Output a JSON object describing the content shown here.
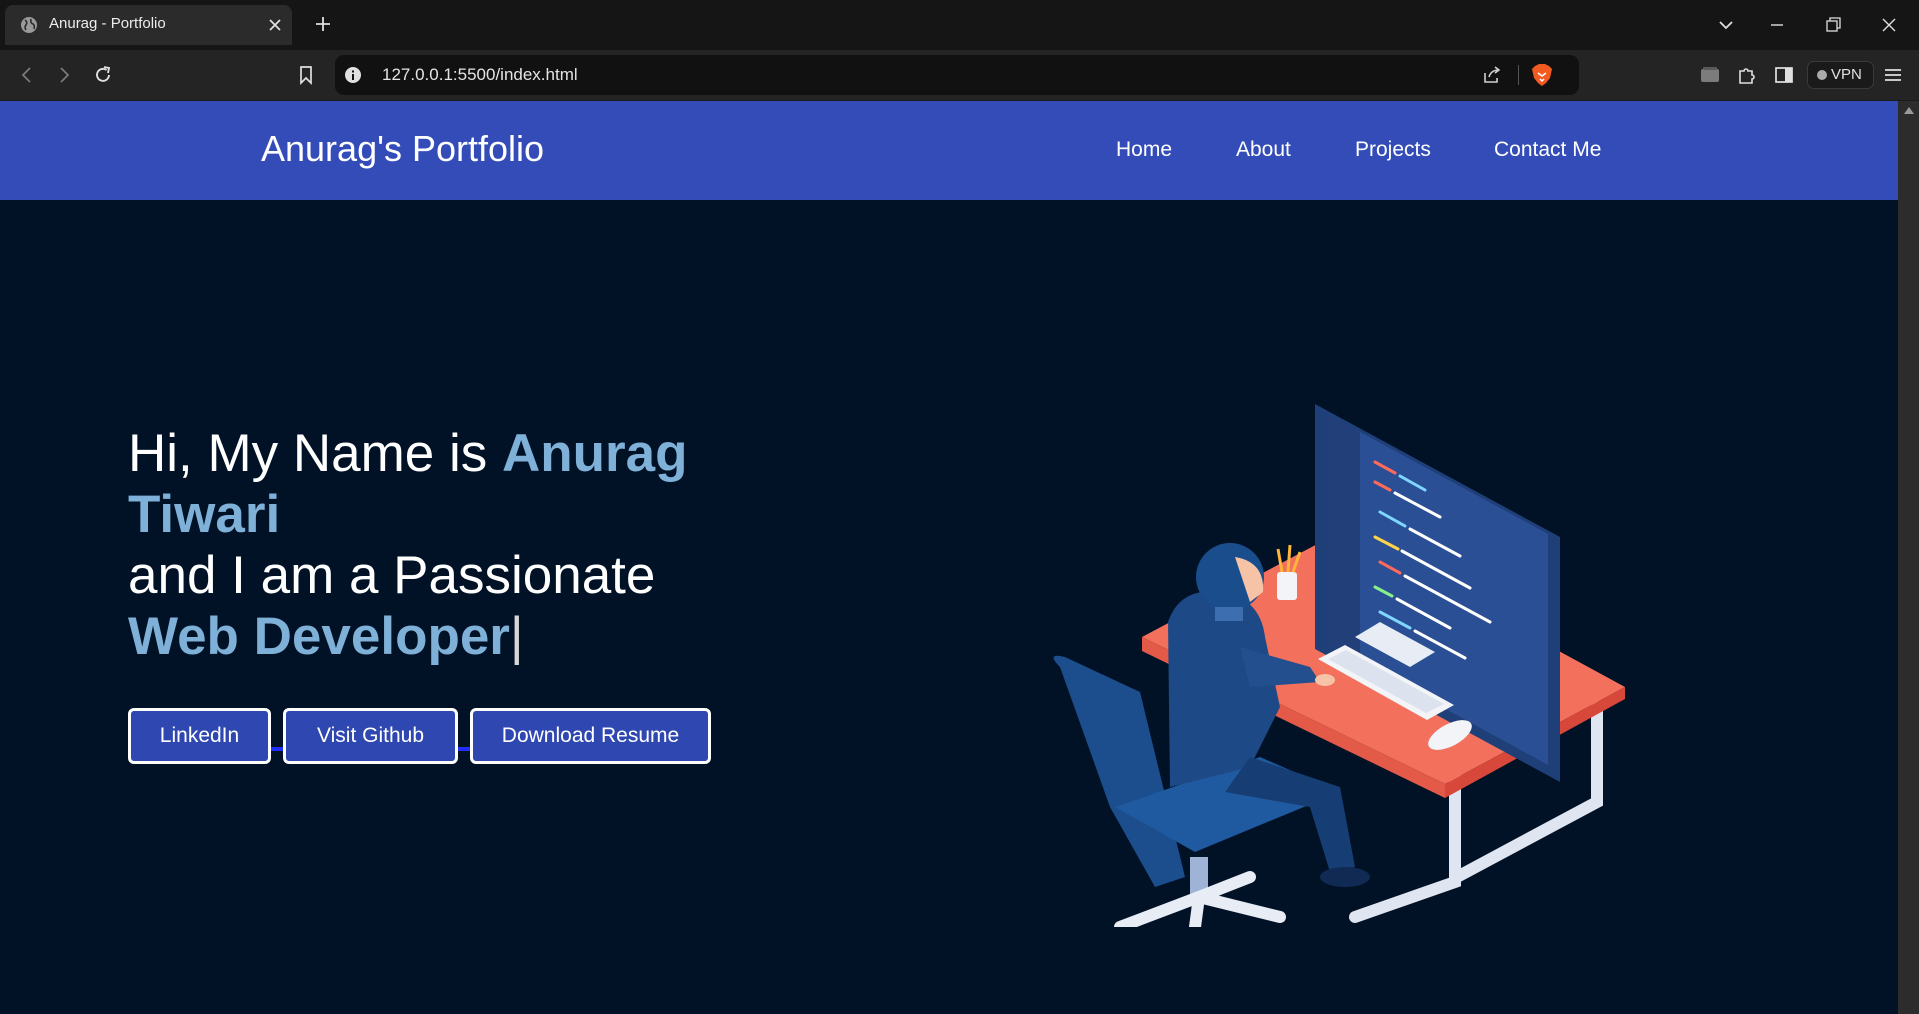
{
  "browser": {
    "tab_title": "Anurag - Portfolio",
    "url": "127.0.0.1:5500/index.html",
    "vpn_label": "VPN"
  },
  "site": {
    "brand": "Anurag's Portfolio",
    "nav": [
      "Home",
      "About",
      "Projects",
      "Contact Me"
    ]
  },
  "hero": {
    "line1_prefix": "Hi, My Name is ",
    "name_first": "Anurag",
    "name_last": "Tiwari",
    "line3": "and I am a Passionate",
    "role": "Web Developer",
    "cursor": "|",
    "buttons": [
      "LinkedIn",
      "Visit Github",
      "Download Resume"
    ]
  },
  "colors": {
    "nav_bg": "#344cb8",
    "page_bg": "#011226",
    "highlight": "#7fb0d8",
    "button_bg": "#2f47b0",
    "desk_top": "#f2705c"
  },
  "icons": [
    "globe-icon",
    "close-icon",
    "plus-icon",
    "chevron-down-icon",
    "minimize-icon",
    "restore-icon",
    "back-icon",
    "forward-icon",
    "reload-icon",
    "bookmark-icon",
    "info-icon",
    "share-icon",
    "brave-lion-icon",
    "wallet-icon",
    "extensions-icon",
    "sidebar-icon",
    "menu-icon"
  ]
}
